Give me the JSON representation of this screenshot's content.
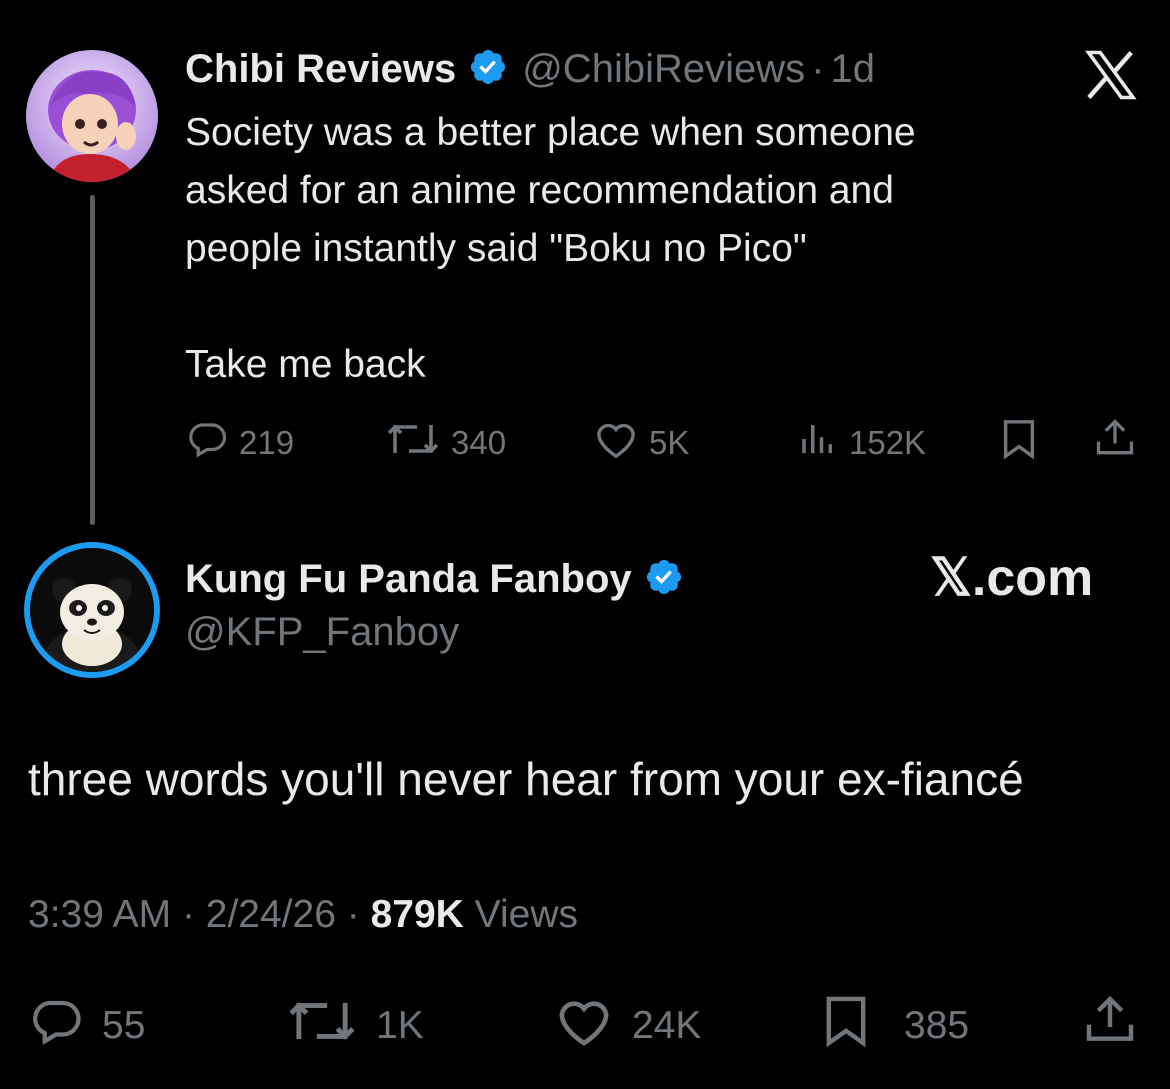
{
  "tweet1": {
    "display_name": "Chibi Reviews",
    "handle": "@ChibiReviews",
    "separator": "·",
    "age": "1d",
    "body": "Society was a better place when someone\nasked for an anime recommendation and\npeople instantly said \"Boku no Pico\"\n\nTake me back",
    "replies": "219",
    "reposts": "340",
    "likes": "5K",
    "views": "152K"
  },
  "tweet2": {
    "display_name": "Kung Fu Panda Fanboy",
    "handle": "@KFP_Fanboy",
    "brand": "𝕏.com",
    "body": "three words you'll never hear from your ex-fiancé",
    "time": "3:39 AM",
    "date": "2/24/26",
    "separator": "·",
    "views_count": "879K",
    "views_label": "Views",
    "replies": "55",
    "reposts": "1K",
    "likes": "24K",
    "bookmarks": "385"
  },
  "colors": {
    "background": "#000000",
    "text": "#e7e9ea",
    "muted": "#71767b",
    "verified": "#1d9bf0"
  },
  "icons": [
    "verified-badge-icon",
    "x-logo-icon",
    "reply-icon",
    "repost-icon",
    "like-icon",
    "views-icon",
    "bookmark-icon",
    "share-icon"
  ]
}
